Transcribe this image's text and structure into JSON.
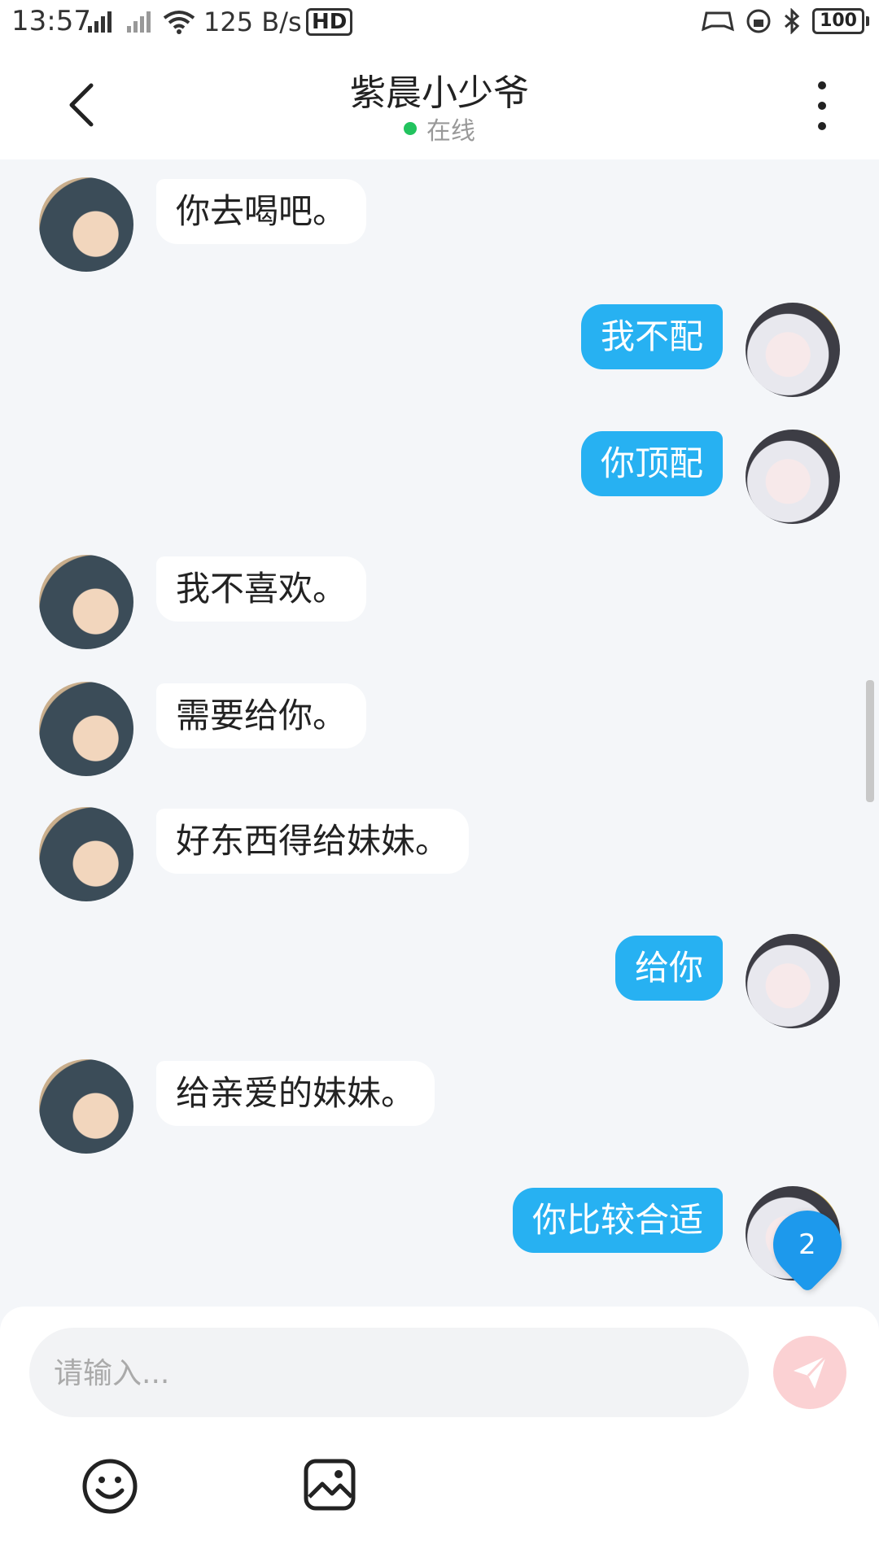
{
  "status_bar": {
    "time": "13:57",
    "net_speed": "125 B/s",
    "hd_label": "HD",
    "battery": "100"
  },
  "header": {
    "title": "紫晨小少爷",
    "presence": "在线"
  },
  "messages": [
    {
      "from": "other",
      "text": "你去喝吧。"
    },
    {
      "from": "me",
      "text": "我不配"
    },
    {
      "from": "me",
      "text": "你顶配"
    },
    {
      "from": "other",
      "text": "我不喜欢。"
    },
    {
      "from": "other",
      "text": "需要给你。"
    },
    {
      "from": "other",
      "text": "好东西得给妹妹。"
    },
    {
      "from": "me",
      "text": "给你"
    },
    {
      "from": "other",
      "text": "给亲爱的妹妹。"
    },
    {
      "from": "me",
      "text": "你比较合适"
    }
  ],
  "unread_count": "2",
  "composer": {
    "placeholder": "请输入..."
  },
  "colors": {
    "my_bubble": "#27b1f2",
    "other_bubble": "#ffffff",
    "online_dot": "#22c35e",
    "badge": "#1d99ec",
    "send_button": "#fbd1d3"
  },
  "icons": [
    "back-arrow-icon",
    "more-vertical-icon",
    "send-icon",
    "emoji-icon",
    "image-icon"
  ]
}
